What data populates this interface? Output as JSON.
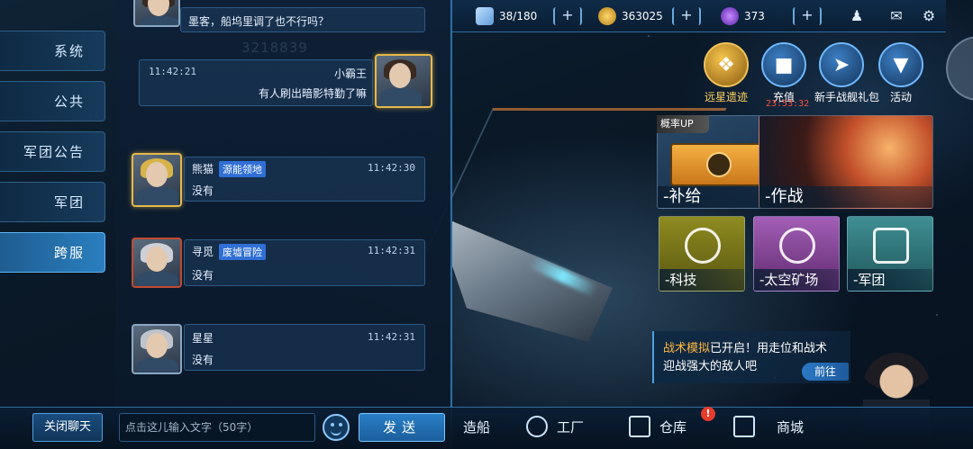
{
  "nav": {
    "items": [
      {
        "label": "系统",
        "active": false
      },
      {
        "label": "公共",
        "active": false
      },
      {
        "label": "军团公告",
        "active": false
      },
      {
        "label": "军团",
        "active": false
      },
      {
        "label": "跨服",
        "active": true
      }
    ]
  },
  "chat": {
    "blurred_id": "3218839",
    "messages": [
      {
        "name": "",
        "time": "",
        "tag": "",
        "text": "墨客，船坞里调了也不行吗？",
        "side": "left"
      },
      {
        "name": "小霸王",
        "time": "11:42:21",
        "tag": "",
        "text": "有人刷出暗影特勤了嘛",
        "side": "right"
      },
      {
        "name": "熊猫",
        "time": "11:42:30",
        "tag": "源能领地",
        "text": "没有",
        "side": "left"
      },
      {
        "name": "寻觅",
        "time": "11:42:31",
        "tag": "废墟冒险",
        "text": "没有",
        "side": "left"
      },
      {
        "name": "星星",
        "time": "11:42:31",
        "tag": "",
        "text": "没有",
        "side": "left"
      }
    ],
    "close_label": "关闭聊天",
    "input_placeholder": "点击这儿输入文字（50字）",
    "send_label": "发送"
  },
  "topbar": {
    "energy": "38/180",
    "gold": "363025",
    "crystal": "373"
  },
  "events": [
    {
      "label": "远星遗迹",
      "icon": "badge-icon"
    },
    {
      "label": "充值",
      "icon": "gift-icon"
    },
    {
      "label": "新手战舰礼包",
      "icon": "ship-icon"
    },
    {
      "label": "活动",
      "icon": "activity-icon"
    }
  ],
  "countdown": "23:53:32",
  "cards": {
    "prob_up": "概率UP",
    "supply": "-补给",
    "battle": "-作战",
    "tech": "-科技",
    "mine": "-太空矿场",
    "legion": "-军团"
  },
  "notice": {
    "highlight": "战术模拟",
    "line1_rest": "已开启！用走位和战术",
    "line2": "迎战强大的敌人吧",
    "goto": "前往"
  },
  "bottom_menu": {
    "shipbuild": "造船",
    "factory": "工厂",
    "warehouse": "仓库",
    "warehouse_badge": "!",
    "shop": "商城"
  },
  "colors": {
    "accent": "#2e6ea3",
    "tag_blue": "#2f6fd6",
    "highlight": "#ffb640",
    "countdown": "#ff4b3a"
  }
}
